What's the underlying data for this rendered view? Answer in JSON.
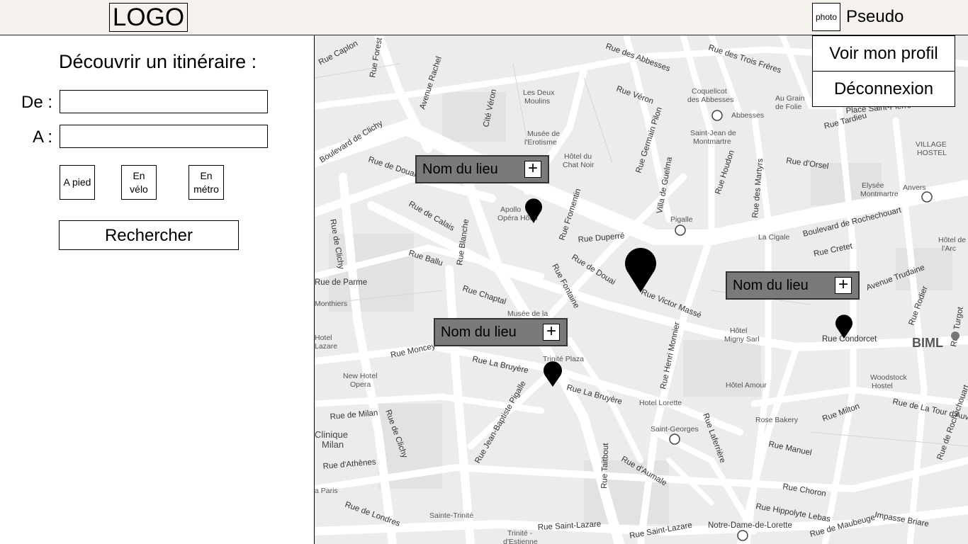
{
  "header": {
    "logo": "LOGO",
    "photo": "photo",
    "pseudo": "Pseudo"
  },
  "user_menu": {
    "items": [
      "Voir mon profil",
      "Déconnexion"
    ]
  },
  "search": {
    "title": "Découvrir un itinéraire :",
    "from_label": "De :",
    "to_label": "A :",
    "from_value": "",
    "to_value": "",
    "modes": [
      "A pied",
      "En vélo",
      "En métro"
    ],
    "button": "Rechercher"
  },
  "map": {
    "places": [
      "Nom du lieu",
      "Nom du lieu",
      "Nom du lieu"
    ],
    "plus_symbol": "+",
    "street_labels": [
      "Rue Caplon",
      "Rue Forest",
      "Avenue Rachel",
      "Cité Véron",
      "Les Deux Moulins",
      "Rue des Abbesses",
      "Rue des Trois Frères",
      "Coquelicot des Abbesses",
      "Au Grain de Folie",
      "Abbesses",
      "Place Saint-Pierre",
      "Rue Véron",
      "Rue Tardieu",
      "Musée de l'Erotisme",
      "Boulevard de Clichy",
      "Saint-Jean de Montmartre",
      "VILLAGE HOSTEL",
      "Rue de Douai",
      "Hôtel du Chat Noir",
      "Rue Germain Pilon",
      "Rue d'Orsel",
      "Rue Houdon",
      "Villa de Guelma",
      "Elysée Montmartre",
      "Anvers",
      "Rue de Calais",
      "Apollo Opéra Hôtel",
      "Rue Fromentin",
      "Pigalle",
      "La Cigale",
      "Boulevard de Rochechouart",
      "Rue de Clichy",
      "Rue Ballu",
      "Rue Duperré",
      "Rue des Martyrs",
      "Rue Cretet",
      "Rue Blanche",
      "Rue Fontaine",
      "Rue de Douai",
      "Avenue Trudaine",
      "Rue Chaptal",
      "Musée de la Vie Romantique",
      "Rue Victor Massé",
      "Rue Rodier",
      "Rue de Parme",
      "Rue Condorcet",
      "BIML",
      "Hôtel Migny Sarl",
      "Rue Moncey",
      "Rue La Bruyère",
      "Trinité Plaza",
      "Rue Henri Monnier",
      "New Hotel Opera",
      "Hôtel Amour",
      "Woodstock Hostel",
      "Rue Jean-Baptiste Pigalle",
      "Rue La Bruyère",
      "Hotel Lorette",
      "Rue Milton",
      "Rue de La Tour d'Auvergne",
      "Rue de Milan",
      "Clinique Milan",
      "Saint-Georges",
      "Rose Bakery",
      "Rue Laferrière",
      "Rue d'Athènes",
      "Rue Taitbout",
      "Rue d'Aumale",
      "Rue Manuel",
      "Rue Choron",
      "Rue Hippolyte Lebas",
      "Rue de Londres",
      "Sainte-Trinité",
      "Rue Saint-Lazare",
      "Notre-Dame-de-Lorette",
      "Rue de Maubeuge",
      "Impasse Briare",
      "Rue de Rochechouart",
      "Trinité - d'Estienne",
      "Hotel Lazare",
      "Monthiers",
      "Rue Turgot",
      "Hôtel de l'Arc"
    ]
  }
}
